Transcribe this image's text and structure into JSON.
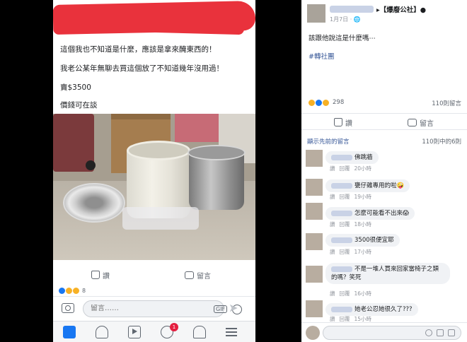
{
  "left": {
    "post_lines": [
      "這個我也不知道是什麼，應該是拿來醃東西的！",
      "我老公某年無聊去買這個放了不知道幾年沒用過！",
      "賣$3500",
      "價錢可在談"
    ],
    "like_label": "讚",
    "comment_label": "留言",
    "reaction_count": "8",
    "comment_placeholder": "留言……",
    "gif_label": "GIF",
    "send_glyph": "➤",
    "notification_badge": "1"
  },
  "right": {
    "group_name": "▸【爆廢公社】●",
    "post_date": "1月7日 · 🌐",
    "post_body": "該跟他說這是什麼嗎⋯",
    "hashtag": "#轉社團",
    "reaction_count": "298",
    "comment_count": "110則留言",
    "like_label": "讚",
    "comment_label": "留言",
    "show_previous": "顯示先前的留言",
    "previous_count": "110則中的6則",
    "comments": [
      {
        "text": "佛跳牆",
        "meta_like": "讚",
        "meta_reply": "回覆",
        "meta_time": "20小時"
      },
      {
        "text": "甕仔雞專用的啦🤪",
        "meta_like": "讚",
        "meta_reply": "回覆",
        "meta_time": "19小時"
      },
      {
        "text": "怎麼可能看不出來😱",
        "meta_like": "讚",
        "meta_reply": "回覆",
        "meta_time": "18小時"
      },
      {
        "text": "3500很便宜耶",
        "meta_like": "讚",
        "meta_reply": "回覆",
        "meta_time": "17小時"
      },
      {
        "text": "不是一堆人買來回家當椅子之類的嗎？笑死",
        "meta_like": "讚",
        "meta_reply": "回覆",
        "meta_time": "16小時"
      },
      {
        "text": "她老公忍她很久了???",
        "meta_like": "讚",
        "meta_reply": "回覆",
        "meta_time": "15小時"
      }
    ]
  },
  "colors": {
    "facebook_blue": "#1877f2",
    "link_blue": "#385898",
    "redaction_red": "#e9323c"
  }
}
